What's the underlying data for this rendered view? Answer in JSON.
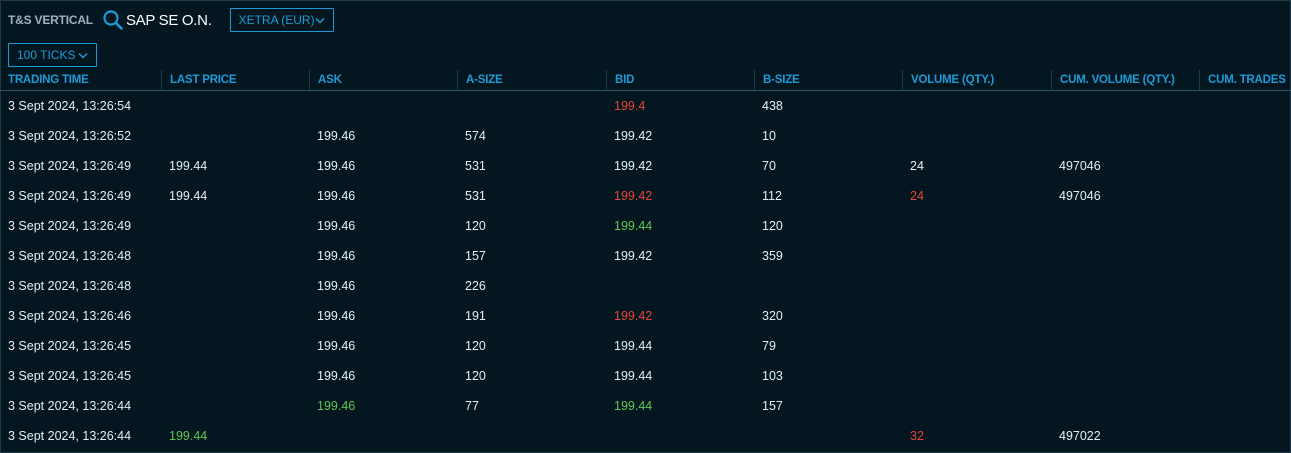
{
  "widget": {
    "title": "T&S VERTICAL",
    "instrument": "SAP SE O.N.",
    "exchange": "XETRA (EUR)",
    "ticks": "100 TICKS"
  },
  "colors": {
    "background": "#04161f",
    "accent": "#1e9bd7",
    "down": "#e8453a",
    "up": "#5ec950",
    "text": "#e8eef1"
  },
  "columns": [
    "TRADING TIME",
    "LAST PRICE",
    "ASK",
    "A-SIZE",
    "BID",
    "B-SIZE",
    "VOLUME (QTY.)",
    "CUM. VOLUME (QTY.)",
    "CUM. TRADES"
  ],
  "rows": [
    {
      "time": "3 Sept 2024, 13:26:54",
      "last": "",
      "ask": "",
      "asize": "",
      "bid": "199.4",
      "bsize": "438",
      "vol": "",
      "cumvol": "",
      "trades": "",
      "hl": {
        "bid": "red"
      }
    },
    {
      "time": "3 Sept 2024, 13:26:52",
      "last": "",
      "ask": "199.46",
      "asize": "574",
      "bid": "199.42",
      "bsize": "10",
      "vol": "",
      "cumvol": "",
      "trades": "",
      "hl": {}
    },
    {
      "time": "3 Sept 2024, 13:26:49",
      "last": "199.44",
      "ask": "199.46",
      "asize": "531",
      "bid": "199.42",
      "bsize": "70",
      "vol": "24",
      "cumvol": "497046",
      "trades": "",
      "hl": {}
    },
    {
      "time": "3 Sept 2024, 13:26:49",
      "last": "199.44",
      "ask": "199.46",
      "asize": "531",
      "bid": "199.42",
      "bsize": "112",
      "vol": "24",
      "cumvol": "497046",
      "trades": "",
      "hl": {
        "bid": "red",
        "vol": "red"
      }
    },
    {
      "time": "3 Sept 2024, 13:26:49",
      "last": "",
      "ask": "199.46",
      "asize": "120",
      "bid": "199.44",
      "bsize": "120",
      "vol": "",
      "cumvol": "",
      "trades": "",
      "hl": {
        "bid": "green"
      }
    },
    {
      "time": "3 Sept 2024, 13:26:48",
      "last": "",
      "ask": "199.46",
      "asize": "157",
      "bid": "199.42",
      "bsize": "359",
      "vol": "",
      "cumvol": "",
      "trades": "",
      "hl": {}
    },
    {
      "time": "3 Sept 2024, 13:26:48",
      "last": "",
      "ask": "199.46",
      "asize": "226",
      "bid": "",
      "bsize": "",
      "vol": "",
      "cumvol": "",
      "trades": "",
      "hl": {}
    },
    {
      "time": "3 Sept 2024, 13:26:46",
      "last": "",
      "ask": "199.46",
      "asize": "191",
      "bid": "199.42",
      "bsize": "320",
      "vol": "",
      "cumvol": "",
      "trades": "",
      "hl": {
        "bid": "red"
      }
    },
    {
      "time": "3 Sept 2024, 13:26:45",
      "last": "",
      "ask": "199.46",
      "asize": "120",
      "bid": "199.44",
      "bsize": "79",
      "vol": "",
      "cumvol": "",
      "trades": "",
      "hl": {}
    },
    {
      "time": "3 Sept 2024, 13:26:45",
      "last": "",
      "ask": "199.46",
      "asize": "120",
      "bid": "199.44",
      "bsize": "103",
      "vol": "",
      "cumvol": "",
      "trades": "",
      "hl": {}
    },
    {
      "time": "3 Sept 2024, 13:26:44",
      "last": "",
      "ask": "199.46",
      "asize": "77",
      "bid": "199.44",
      "bsize": "157",
      "vol": "",
      "cumvol": "",
      "trades": "",
      "hl": {
        "ask": "green",
        "bid": "green"
      }
    },
    {
      "time": "3 Sept 2024, 13:26:44",
      "last": "199.44",
      "ask": "",
      "asize": "",
      "bid": "",
      "bsize": "",
      "vol": "32",
      "cumvol": "497022",
      "trades": "",
      "hl": {
        "last": "green",
        "vol": "red"
      }
    }
  ],
  "icons": {
    "search": "search-icon",
    "dropdown": "chevron-down-icon"
  }
}
